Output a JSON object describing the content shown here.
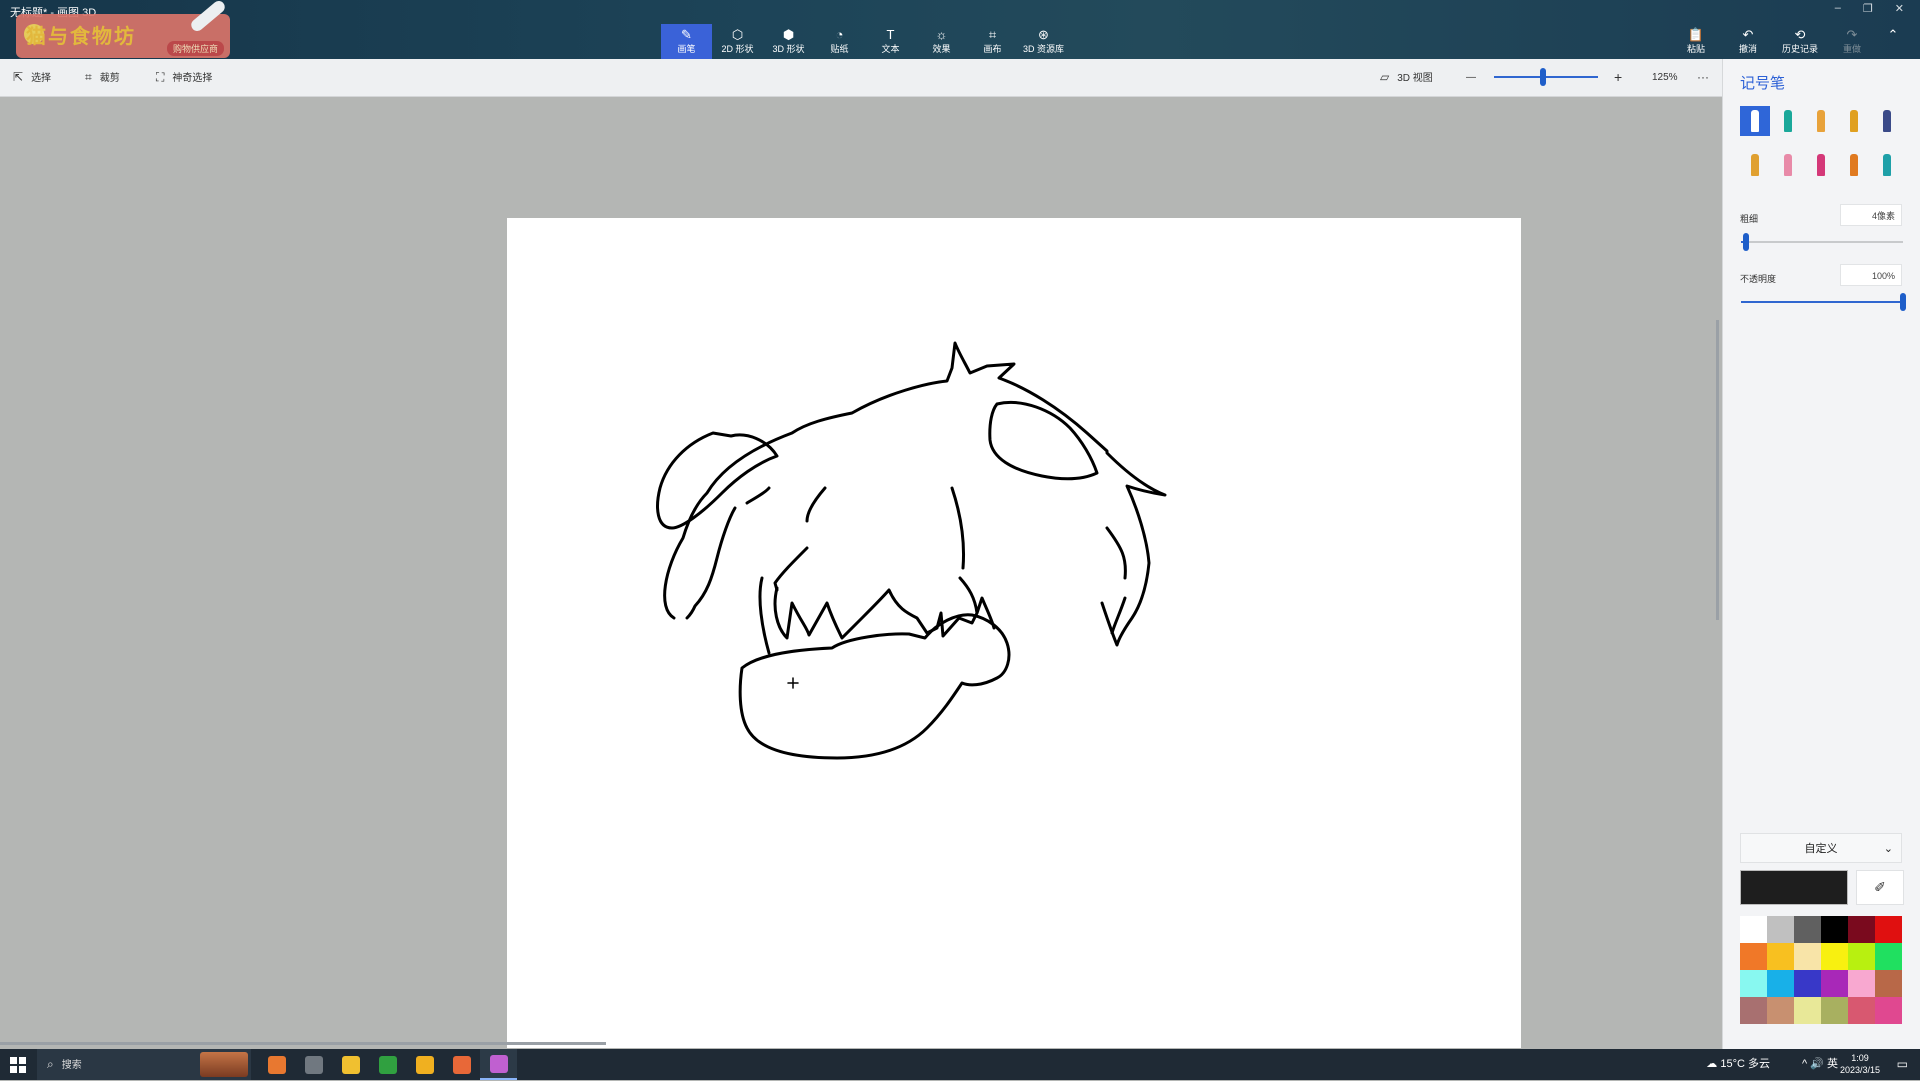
{
  "window": {
    "title": "无标题* - 画图 3D",
    "controls": [
      "–",
      "❐",
      "✕"
    ]
  },
  "logo": {
    "text": "猫与食物坊",
    "subtitle": "购物供应商"
  },
  "toolbar": {
    "tools": [
      {
        "label": "画笔",
        "icon": "brush-icon",
        "glyph": "✎",
        "active": true
      },
      {
        "label": "2D 形状",
        "icon": "2d-shapes-icon",
        "glyph": "⬡",
        "active": false
      },
      {
        "label": "3D 形状",
        "icon": "3d-shapes-icon",
        "glyph": "⬢",
        "active": false
      },
      {
        "label": "贴纸",
        "icon": "sticker-icon",
        "glyph": "◔",
        "active": false
      },
      {
        "label": "文本",
        "icon": "text-icon",
        "glyph": "T",
        "active": false
      },
      {
        "label": "效果",
        "icon": "effects-icon",
        "glyph": "☼",
        "active": false
      },
      {
        "label": "画布",
        "icon": "canvas-icon",
        "glyph": "⌗",
        "active": false
      },
      {
        "label": "3D 资源库",
        "icon": "3d-library-icon",
        "glyph": "⊛",
        "active": false
      }
    ],
    "right": [
      {
        "label": "粘贴",
        "icon": "paste-icon",
        "glyph": "📋",
        "disabled": false
      },
      {
        "label": "撤消",
        "icon": "undo-icon",
        "glyph": "↶",
        "disabled": false
      },
      {
        "label": "历史记录",
        "icon": "history-icon",
        "glyph": "⟲",
        "disabled": false
      },
      {
        "label": "重做",
        "icon": "redo-icon",
        "glyph": "↷",
        "disabled": true
      }
    ],
    "collapse_glyph": "⌃"
  },
  "subbar": {
    "select": "选择",
    "crop": "裁剪",
    "magic_select": "神奇选择",
    "view3d": "3D 视图",
    "zoom_minus": "—",
    "zoom_plus": "+",
    "zoom": "125%",
    "zoom_fraction": 0.47,
    "more": "···"
  },
  "panel": {
    "title": "记号笔",
    "brushes": [
      {
        "name": "marker-icon",
        "color": "#2f66d8"
      },
      {
        "name": "calligraphy-pen-icon",
        "color": "#1aa89a"
      },
      {
        "name": "oil-brush-icon",
        "color": "#e8a23a"
      },
      {
        "name": "watercolor-icon",
        "color": "#e0a020"
      },
      {
        "name": "pixel-pen-icon",
        "color": "#3a4a88"
      },
      {
        "name": "pencil-icon",
        "color": "#e0a030"
      },
      {
        "name": "eraser-icon",
        "color": "#e88aa8"
      },
      {
        "name": "crayon-icon",
        "color": "#d43878"
      },
      {
        "name": "spray-can-icon",
        "color": "#e07a20"
      },
      {
        "name": "fill-icon",
        "color": "#1ea0a8"
      }
    ],
    "thickness_label": "粗细",
    "thickness_value": "4像素",
    "thickness_fraction": 0.03,
    "opacity_label": "不透明度",
    "opacity_value": "100%",
    "opacity_fraction": 1.0,
    "dropdown": "自定义",
    "current_color": "#1e1e1e",
    "swatches": [
      "#ffffff",
      "#c0c0c0",
      "#606060",
      "#000000",
      "#7a0a1e",
      "#e01010",
      "#f07828",
      "#f8c020",
      "#f8e4a8",
      "#f8f010",
      "#b8f010",
      "#20e060",
      "#88f8f0",
      "#18b0e8",
      "#3838c8",
      "#a828b8",
      "#f8a8d0",
      "#b86848",
      "#a87070",
      "#c89070",
      "#e8e898",
      "#a8b060",
      "#d85870",
      "#e04890"
    ]
  },
  "taskbar": {
    "search_placeholder": "搜索",
    "apps": [
      {
        "name": "help-app-icon",
        "color": "#e87830"
      },
      {
        "name": "clock-app-icon",
        "color": "#707880"
      },
      {
        "name": "bilibili-app-icon",
        "color": "#f0c030"
      },
      {
        "name": "xbox-app-icon",
        "color": "#30a040"
      },
      {
        "name": "browser-app-icon",
        "color": "#f0b020"
      },
      {
        "name": "store-app-icon",
        "color": "#e86838"
      },
      {
        "name": "paint3d-app-icon",
        "color": "#c060d0"
      }
    ],
    "weather": "15°C  多云",
    "tray": "^  🔊  英",
    "time": "1:09",
    "date": "2023/3/15"
  }
}
